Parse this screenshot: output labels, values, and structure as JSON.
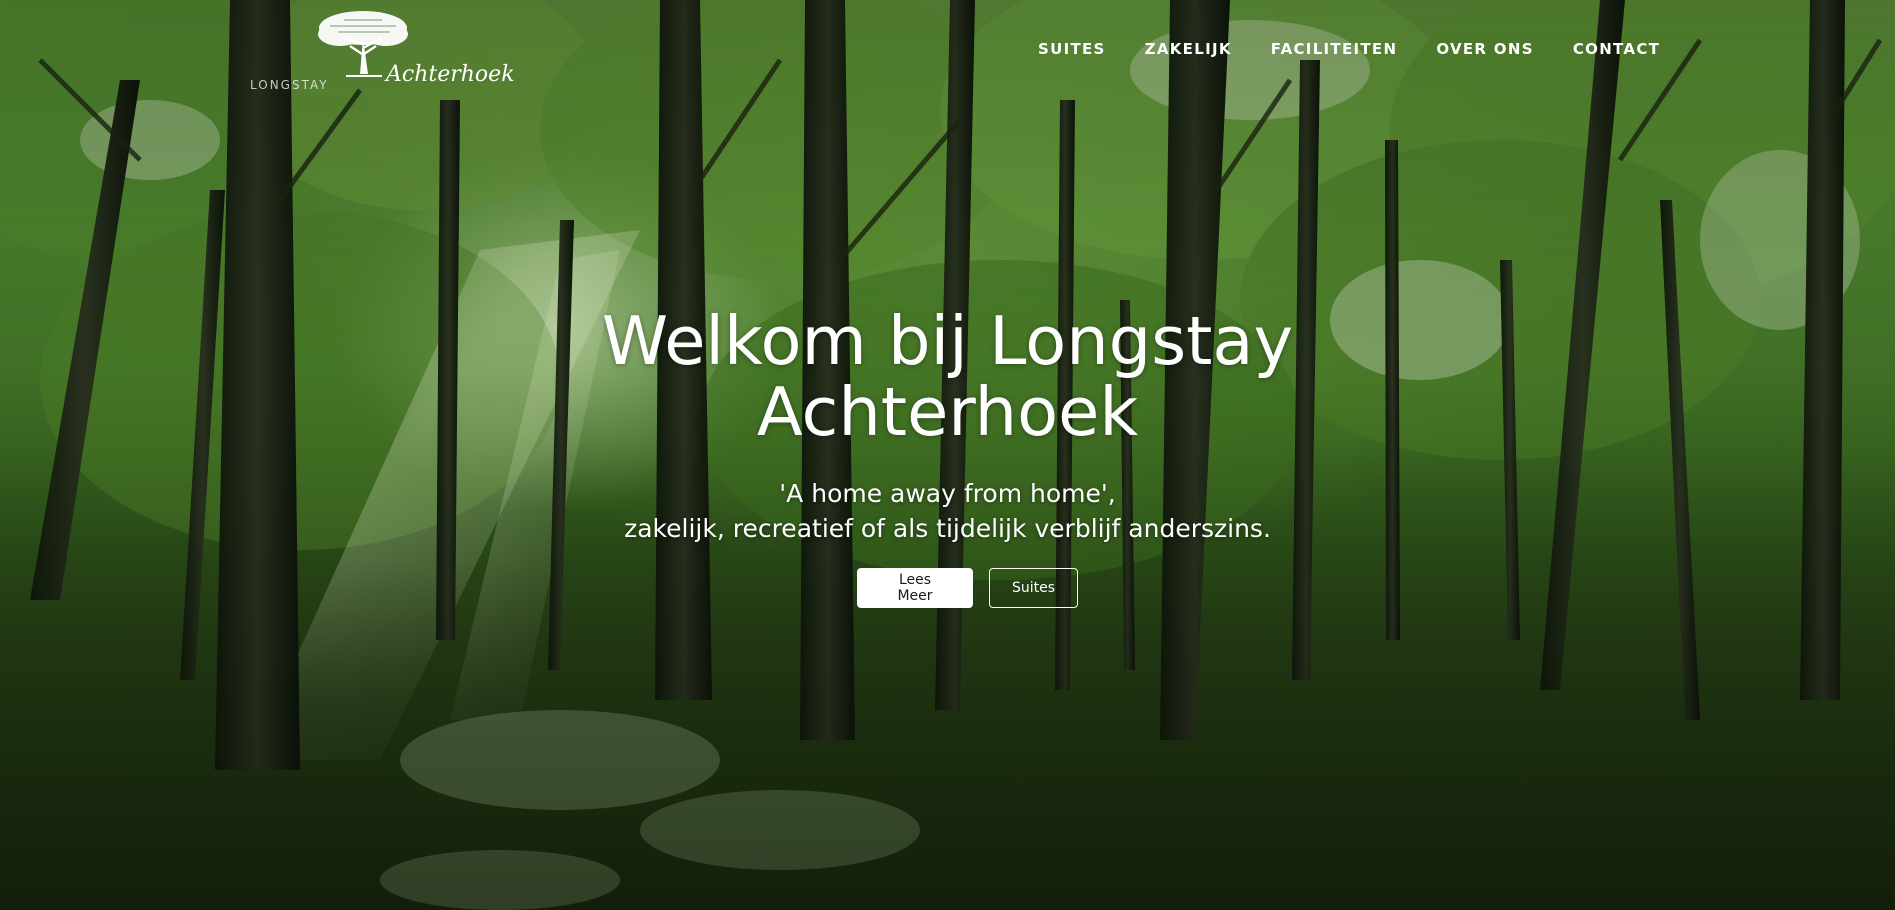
{
  "brand": {
    "logo_left": "LONGSTAY",
    "logo_right": "Achterhoek",
    "logo_icon": "tree-icon"
  },
  "nav": {
    "items": [
      {
        "label": "SUITES"
      },
      {
        "label": "ZAKELIJK"
      },
      {
        "label": "FACILITEITEN"
      },
      {
        "label": "OVER ONS"
      },
      {
        "label": "CONTACT"
      }
    ]
  },
  "hero": {
    "title": "Welkom bij Longstay Achterhoek",
    "subtitle_line1": "'A home away from home',",
    "subtitle_line2": "zakelijk, recreatief of als tijdelijk verblijf anderszins.",
    "primary_button": "Lees Meer",
    "secondary_button": "Suites"
  },
  "colors": {
    "text": "#ffffff",
    "forest": "#3d6d22",
    "button_bg": "#ffffff",
    "button_text": "#1a1a1a"
  }
}
